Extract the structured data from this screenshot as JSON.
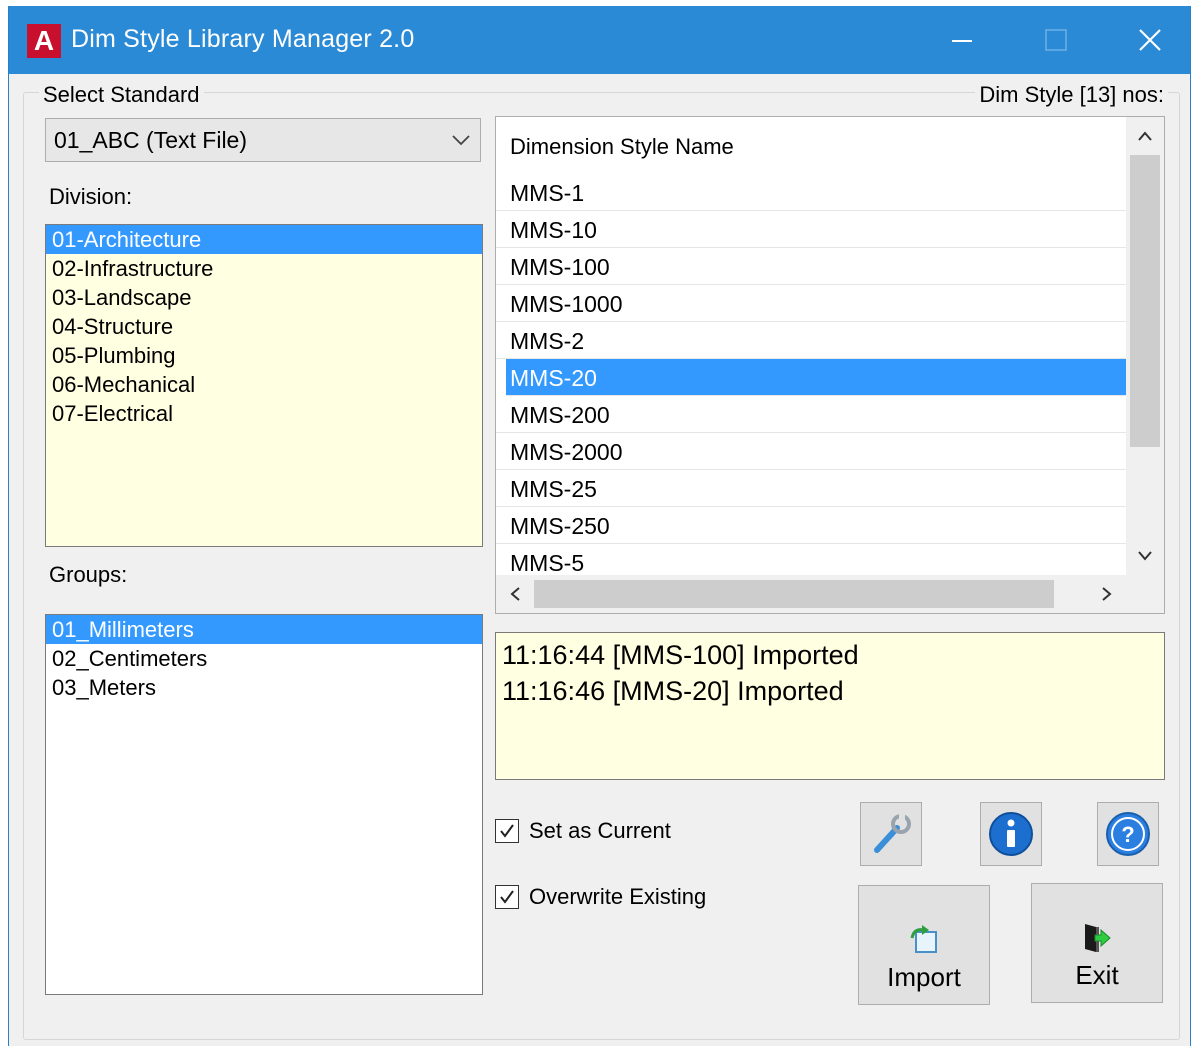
{
  "window": {
    "title": "Dim Style Library Manager 2.0",
    "app_icon_letter": "A",
    "controls": [
      "minimize-icon",
      "maximize-icon",
      "close-icon"
    ]
  },
  "standard": {
    "legend": "Select Standard",
    "selected": "01_ABC (Text File)"
  },
  "dimstyle_legend": "Dim Style [13] nos:",
  "division": {
    "label": "Division:",
    "items": [
      "01-Architecture",
      "02-Infrastructure",
      "03-Landscape",
      "04-Structure",
      "05-Plumbing",
      "06-Mechanical",
      "07-Electrical"
    ],
    "selected_index": 0
  },
  "groups": {
    "label": "Groups:",
    "items": [
      "01_Millimeters",
      "02_Centimeters",
      "03_Meters"
    ],
    "selected_index": 0
  },
  "styles": {
    "column_header": "Dimension Style Name",
    "rows": [
      "MMS-1",
      "MMS-10",
      "MMS-100",
      "MMS-1000",
      "MMS-2",
      "MMS-20",
      "MMS-200",
      "MMS-2000",
      "MMS-25",
      "MMS-250",
      "MMS-5"
    ],
    "selected_index": 5
  },
  "log": {
    "lines": [
      "11:16:44 [MMS-100] Imported",
      "11:16:46 [MMS-20] Imported"
    ]
  },
  "options": {
    "set_current_label": "Set as Current",
    "set_current_checked": true,
    "overwrite_label": "Overwrite Existing",
    "overwrite_checked": true
  },
  "buttons": {
    "import_label": "Import",
    "exit_label": "Exit",
    "settings_icon": "wrench-icon",
    "info_icon": "info-icon",
    "help_icon": "help-icon"
  },
  "colors": {
    "titlebar": "#2b8ad6",
    "selection": "#3399ff",
    "list_background": "#ffffe1"
  }
}
